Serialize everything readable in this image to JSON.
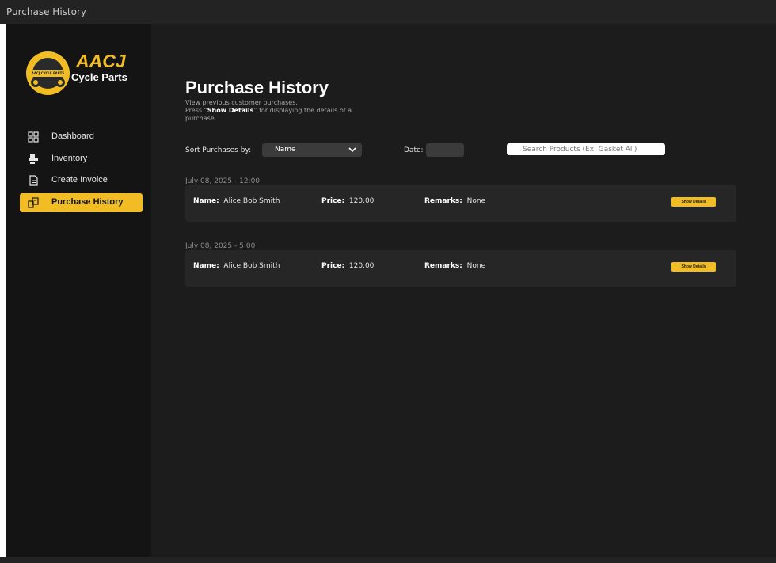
{
  "window": {
    "title": "Purchase History"
  },
  "brand": {
    "name": "AACJ",
    "subtitle": "Cycle Parts",
    "badge_text": "AACJ CYCLE PARTS"
  },
  "sidebar": {
    "items": [
      {
        "label": "Dashboard",
        "icon": "grid-icon",
        "active": false
      },
      {
        "label": "Inventory",
        "icon": "boxes-icon",
        "active": false
      },
      {
        "label": "Create Invoice",
        "icon": "document-icon",
        "active": false
      },
      {
        "label": "Purchase History",
        "icon": "history-icon",
        "active": true
      }
    ]
  },
  "header": {
    "title": "Purchase History",
    "desc_line1": "View previous customer purchases.",
    "desc_press": "Press “",
    "desc_bold": "Show Details",
    "desc_rest": "” for displaying the details of a purchase."
  },
  "filters": {
    "sort_label": "Sort Purchases  by:",
    "sort_value": "Name",
    "date_label": "Date:",
    "search_placeholder": "Search Products (Ex. Gasket All)"
  },
  "labels": {
    "name": "Name:",
    "price": "Price:",
    "remarks": "Remarks:",
    "show_details": "Show Details"
  },
  "purchases": [
    {
      "date": "July 08, 2025  - 12:00",
      "name": "Alice Bob Smith",
      "price": "120.00",
      "remarks": "None"
    },
    {
      "date": "July 08, 2025  - 5:00",
      "name": "Alice Bob Smith",
      "price": "120.00",
      "remarks": "None"
    }
  ],
  "colors": {
    "accent": "#f2bd24",
    "sidebar": "#141414",
    "main": "#1c1c1c",
    "card": "#262626"
  }
}
